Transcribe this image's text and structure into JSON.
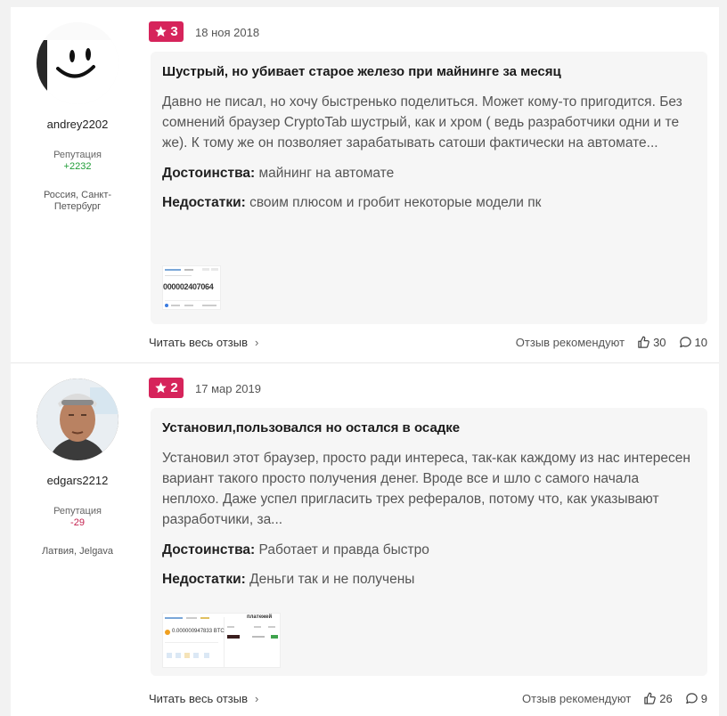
{
  "colors": {
    "rating_bg": "#d6245b",
    "rep_positive": "#1e9c36",
    "rep_negative": "#c4214e"
  },
  "reviews": [
    {
      "author": "andrey2202",
      "rep_label": "Репутация",
      "rep_value": "+2232",
      "location": "Россия, Санкт-Петербург",
      "rating": "3",
      "date": "18 ноя 2018",
      "title": "Шустрый, но убивает старое железо при майнинге за месяц",
      "text": "Давно не писал, но хочу быстренько поделиться. Может кому-то пригодится. Без сомнений браузер CryptoTab шустрый, как и хром ( ведь разработчики одни и те же). К тому же он позволяет зарабатывать сатоши фактически на автомате...",
      "pros_label": "Достоинства:",
      "pros": "майнинг на автомате",
      "cons_label": "Недостатки:",
      "cons": "своим плюсом и гробит некоторые модели пк",
      "thumb_text": "000002407064",
      "read_more": "Читать весь отзыв",
      "recommend_label": "Отзыв рекомендуют",
      "likes": "30",
      "comments": "10"
    },
    {
      "author": "edgars2212",
      "rep_label": "Репутация",
      "rep_value": "-29",
      "location": "Латвия, Jelgava",
      "rating": "2",
      "date": "17 мар 2019",
      "title": "Установил,пользовался но остался в осадке",
      "text": "Установил этот браузер, просто ради интереса, так-как каждому из нас интересен вариант такого просто получения денег. Вроде все и шло с самого начала неплохо. Даже успел пригласить трех рефералов, потому что, как указывают разработчики, за...",
      "pros_label": "Достоинства:",
      "pros": "Работает и правда быстро",
      "cons_label": "Недостатки:",
      "cons": "Деньги так и не получены",
      "thumb_text": "0.000000947833 BTC",
      "thumb_heading": "платежей",
      "read_more": "Читать весь отзыв",
      "recommend_label": "Отзыв рекомендуют",
      "likes": "26",
      "comments": "9"
    }
  ]
}
